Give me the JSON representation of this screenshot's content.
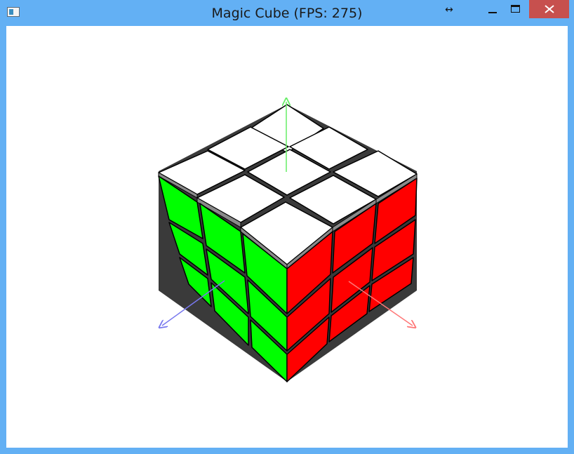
{
  "window": {
    "title": "Magic Cube (FPS: 275)"
  },
  "titlebar_icons": {
    "app": "app-window-icon",
    "resize": "resize-arrows-icon",
    "minimize": "minimize-icon",
    "maximize": "maximize-icon",
    "close": "close-icon"
  },
  "colors": {
    "titlebar": "#63b0f4",
    "close_button": "#c7504e",
    "top_face": "#ffffff",
    "left_face": "#00ff00",
    "right_face": "#ff0000",
    "axis_y": "#66ee66",
    "axis_x": "#ff7777",
    "axis_z": "#7777ee"
  },
  "scene": {
    "top_face_color": "white",
    "left_face_color": "green",
    "right_face_color": "red",
    "cube_grid": "3x3x3"
  }
}
